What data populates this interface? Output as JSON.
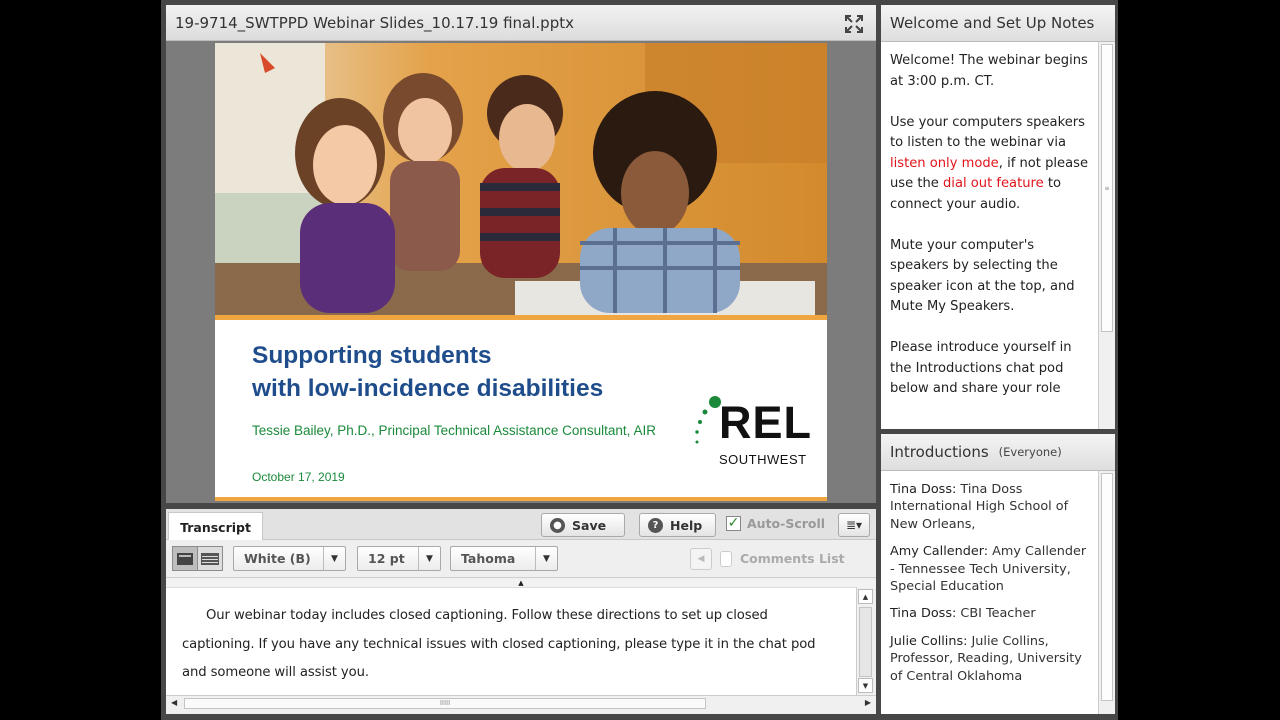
{
  "share_pod": {
    "title": "19-9714_SWTPPD Webinar Slides_10.17.19 final.pptx",
    "fullscreen_icon": "expand-arrows-icon"
  },
  "slide": {
    "title_line1": "Supporting students",
    "title_line2": "with low-incidence disabilities",
    "author": "Tessie Bailey, Ph.D., Principal Technical Assistance Consultant, AIR",
    "date": "October 17, 2019",
    "logo_main": "REL",
    "logo_sub": "SOUTHWEST",
    "colors": {
      "title": "#1f4d8c",
      "green": "#1a8a3a",
      "stripe": "#f0a640"
    }
  },
  "captions": {
    "tab_label": "Transcript",
    "save_label": "Save",
    "help_label": "Help",
    "autoscroll_label": "Auto-Scroll",
    "autoscroll_checked": true,
    "color_value": "White (B)",
    "size_value": "12 pt",
    "font_value": "Tahoma",
    "comments_label": "Comments List",
    "text": "Our webinar today includes closed captioning.  Follow these directions to set up closed captioning.  If you have any technical issues with closed captioning, please type it in the chat pod and someone will assist you."
  },
  "notes": {
    "title": "Welcome and Set Up Notes",
    "p1": "Welcome! The webinar begins at 3:00 p.m. CT.",
    "p2_a": "Use your computers speakers to listen to the webinar via ",
    "p2_red1": "listen only mode",
    "p2_b": ", if not please use the ",
    "p2_red2": "dial out feature",
    "p2_c": " to connect your audio.",
    "p3": "Mute your computer's speakers by selecting the speaker icon at the top, and Mute My Speakers.",
    "p4": "Please introduce yourself in the Introductions chat pod below and share your role"
  },
  "chat": {
    "title": "Introductions",
    "audience": "(Everyone)",
    "messages": [
      {
        "name": "Tina Doss:",
        "text": " Tina Doss International High School of New Orleans,"
      },
      {
        "name": "Amy Callender:",
        "text": " Amy Callender - Tennessee Tech University, Special Education"
      },
      {
        "name": "Tina Doss:",
        "text": " CBI Teacher"
      },
      {
        "name": "Julie Collins:",
        "text": " Julie Collins, Professor, Reading, University of Central Oklahoma"
      }
    ]
  }
}
